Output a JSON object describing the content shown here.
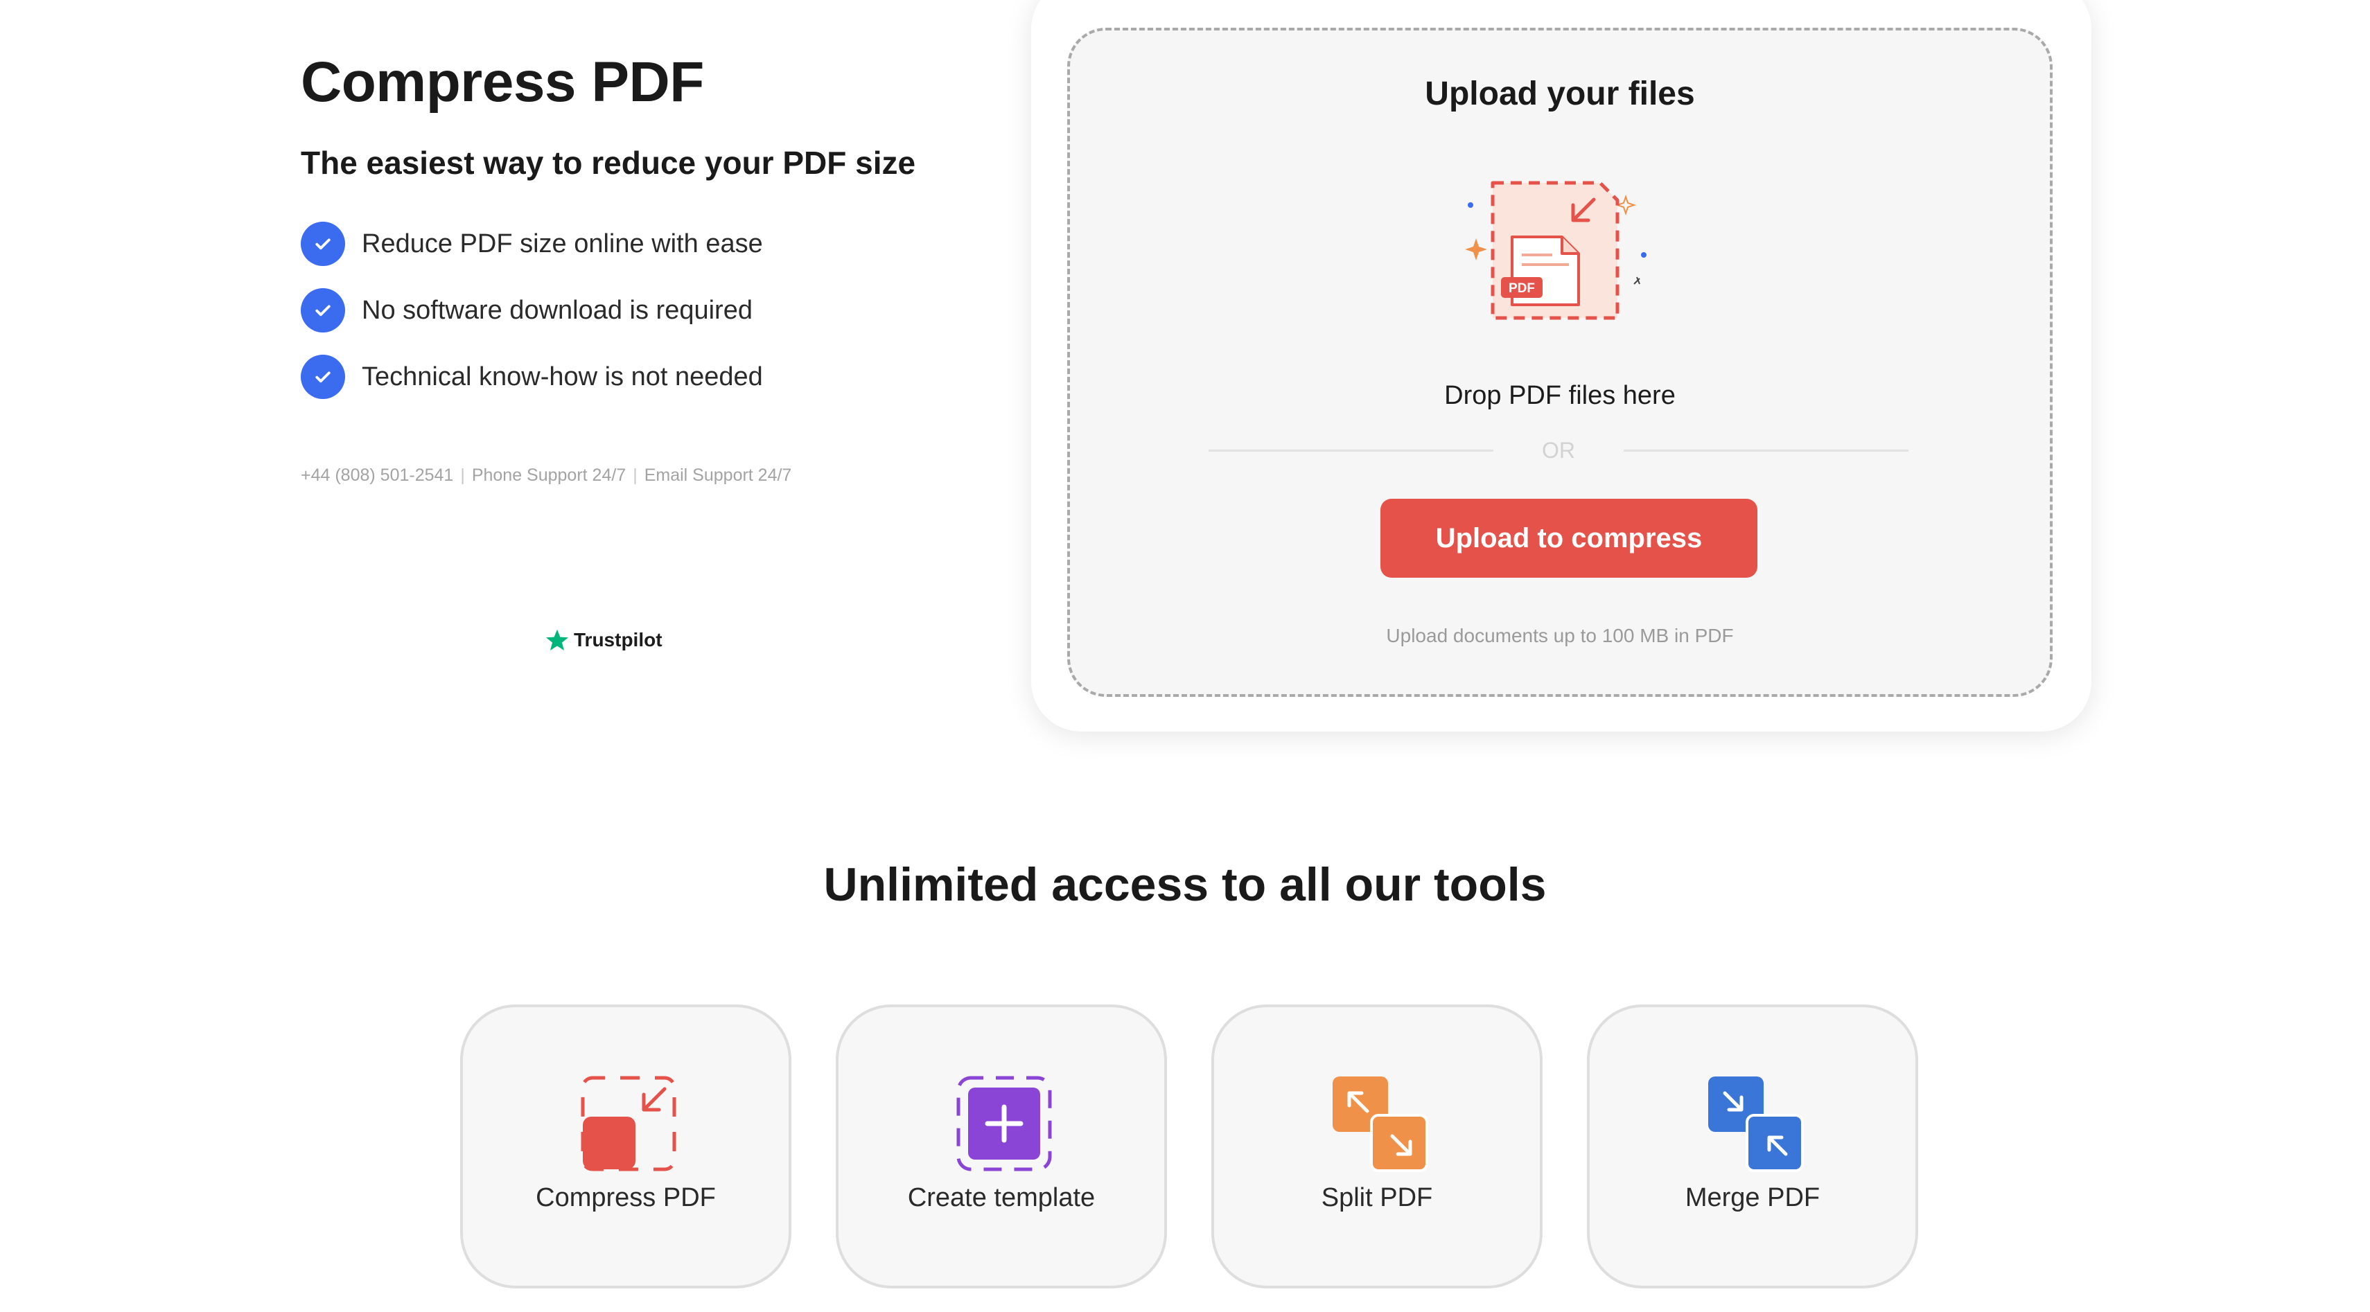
{
  "hero": {
    "title": "Compress PDF",
    "subtitle": "The easiest way to reduce your PDF size",
    "features": [
      "Reduce PDF size online with ease",
      "No software download is required",
      "Technical know-how is not needed"
    ],
    "support": {
      "phone": "+44 (808) 501-2541",
      "phone_support": "Phone Support 24/7",
      "email_support": "Email Support 24/7",
      "separator": "|"
    },
    "trustpilot": "Trustpilot"
  },
  "upload": {
    "title": "Upload your files",
    "pdf_badge": "PDF",
    "drop_text": "Drop PDF files here",
    "or_text": "OR",
    "button_label": "Upload to compress",
    "note": "Upload documents up to 100 MB in PDF"
  },
  "tools": {
    "heading": "Unlimited access to all our tools",
    "items": [
      {
        "label": "Compress PDF",
        "icon": "compress-icon"
      },
      {
        "label": "Create template",
        "icon": "create-template-icon"
      },
      {
        "label": "Split PDF",
        "icon": "split-icon"
      },
      {
        "label": "Merge PDF",
        "icon": "merge-icon"
      }
    ]
  },
  "colors": {
    "accent_red": "#e5524a",
    "check_blue": "#3b6cf0",
    "trustpilot_green": "#00b67a",
    "purple": "#8a44d6",
    "orange": "#f0914a",
    "blue": "#3a76d8"
  }
}
